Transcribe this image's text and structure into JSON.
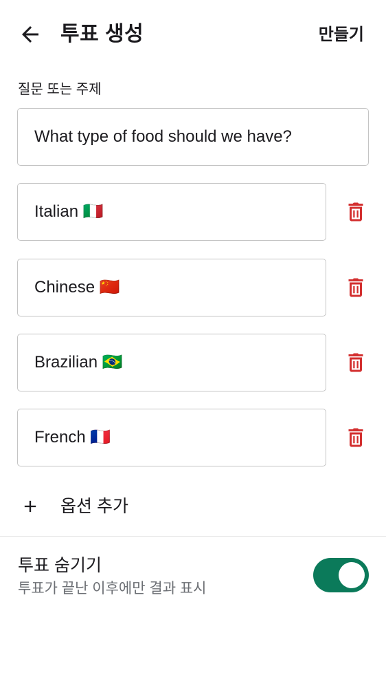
{
  "header": {
    "title": "투표 생성",
    "create_label": "만들기",
    "back_icon": "arrow-left-icon"
  },
  "question": {
    "label": "질문 또는 주제",
    "value": "What type of food should we have?"
  },
  "options": [
    {
      "value": "Italian 🇮🇹"
    },
    {
      "value": "Chinese 🇨🇳"
    },
    {
      "value": "Brazilian 🇧🇷"
    },
    {
      "value": "French 🇫🇷"
    }
  ],
  "delete_icon": "trash-icon",
  "add_option": {
    "label": "옵션 추가",
    "icon": "plus-icon"
  },
  "hide_votes": {
    "title": "투표 숨기기",
    "subtitle": "투표가 끝난 이후에만 결과 표시",
    "enabled": true
  },
  "colors": {
    "accent": "#0b7a5a",
    "delete": "#d32f2f",
    "text": "#1c1b1f",
    "secondary_text": "#6c6f74",
    "border": "#c4c4c4"
  }
}
